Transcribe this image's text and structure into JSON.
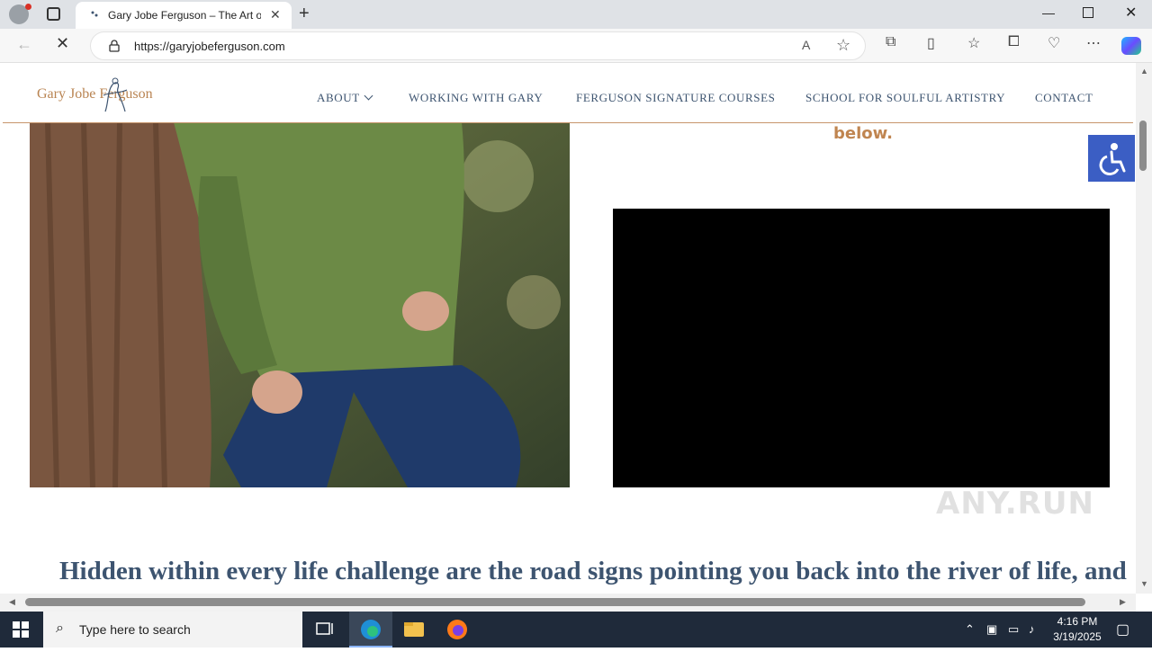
{
  "browser": {
    "tab_title": "Gary Jobe Ferguson – The Art of",
    "url": "https://garyjobeferguson.com",
    "new_tab_glyph": "+",
    "close_glyph": "✕",
    "minimize_glyph": "—"
  },
  "site": {
    "logo_text": "Gary Jobe Ferguson",
    "nav": [
      {
        "label": "ABOUT"
      },
      {
        "label": "WORKING WITH GARY"
      },
      {
        "label": "FERGUSON SIGNATURE COURSES"
      },
      {
        "label": "SCHOOL FOR SOULFUL ARTISTRY"
      },
      {
        "label": "CONTACT"
      }
    ],
    "right_text": "below.",
    "headline": "Hidden within every life challenge are the road signs pointing you back into the river of life, and"
  },
  "watermark": "ANY.RUN",
  "taskbar": {
    "search_placeholder": "Type here to search",
    "time": "4:16 PM",
    "date": "3/19/2025"
  },
  "colors": {
    "brand_gold": "#c08550",
    "nav_blue": "#3d5470",
    "a11y_blue": "#3b5ec4"
  }
}
